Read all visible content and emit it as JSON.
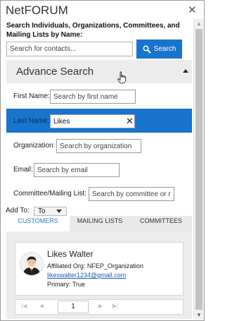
{
  "app": {
    "title": "NetFORUM",
    "close_glyph": "✕"
  },
  "search": {
    "heading": "Search Individuals, Organizations, Committees, and Mailing Lists by Name:",
    "placeholder": "Search for contacts...",
    "button_label": "Search",
    "button_icon": "search-icon"
  },
  "advanced": {
    "title": "Advance Search",
    "fields": [
      {
        "label": "First Name:",
        "placeholder": "Search by first name",
        "value": ""
      },
      {
        "label": "Last Name:",
        "placeholder": "",
        "value": "Likes",
        "selected": true
      },
      {
        "label": "Organization:",
        "placeholder": "Search by organization",
        "value": ""
      },
      {
        "label": "Email:",
        "placeholder": "Search by email",
        "value": ""
      },
      {
        "label": "Committee/Mailing List:",
        "placeholder": "Search by committee or ma",
        "value": ""
      }
    ]
  },
  "add_to": {
    "label": "Add To:",
    "selected": "To"
  },
  "tabs": [
    {
      "label": "CUSTOMERS",
      "active": true
    },
    {
      "label": "MAILING LISTS",
      "active": false
    },
    {
      "label": "COMMITTEES",
      "active": false
    }
  ],
  "results": [
    {
      "name": "Likes Walter",
      "affiliated_org": "Affiliated Org: NFEP_Organization",
      "email": "likeswalter1234@gmail.com",
      "primary": "Primary: True",
      "avatar_icon": "person-avatar-icon"
    }
  ],
  "pager": {
    "current_page": "1",
    "first_icon": "first-page-icon",
    "prev_icon": "prev-page-icon",
    "next_icon": "next-page-icon",
    "last_icon": "last-page-icon"
  },
  "colors": {
    "accent": "#1874cd",
    "link": "#1a5fb4",
    "panel_bg": "#ececec"
  }
}
